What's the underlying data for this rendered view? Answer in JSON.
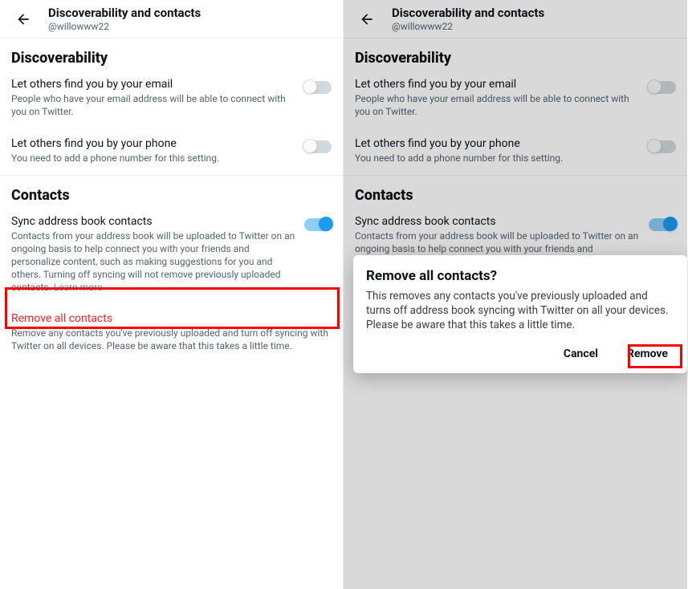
{
  "header": {
    "title": "Discoverability and contacts",
    "subtitle": "@willowww22"
  },
  "sections": {
    "discoverability": {
      "heading": "Discoverability",
      "email": {
        "title": "Let others find you by your email",
        "desc": "People who have your email address will be able to connect with you on Twitter."
      },
      "phone": {
        "title": "Let others find you by your phone",
        "desc": "You need to add a phone number for this setting."
      }
    },
    "contacts": {
      "heading": "Contacts",
      "sync": {
        "title": "Sync address book contacts",
        "desc": "Contacts from your address book will be uploaded to Twitter on an ongoing basis to help connect you with your friends and personalize content, such as making suggestions for you and others. Turning off syncing will not remove previously uploaded contacts. ",
        "learn_more": "Learn more"
      },
      "remove": {
        "title": "Remove all contacts",
        "desc": "Remove any contacts you've previously uploaded and turn off syncing with Twitter on all devices. Please be aware that this takes a little time."
      }
    }
  },
  "dialog": {
    "title": "Remove all contacts?",
    "body": "This removes any contacts you've previously uploaded and turns off address book syncing with Twitter on all your devices. Please be aware that this takes a little time.",
    "cancel": "Cancel",
    "remove": "Remove"
  }
}
